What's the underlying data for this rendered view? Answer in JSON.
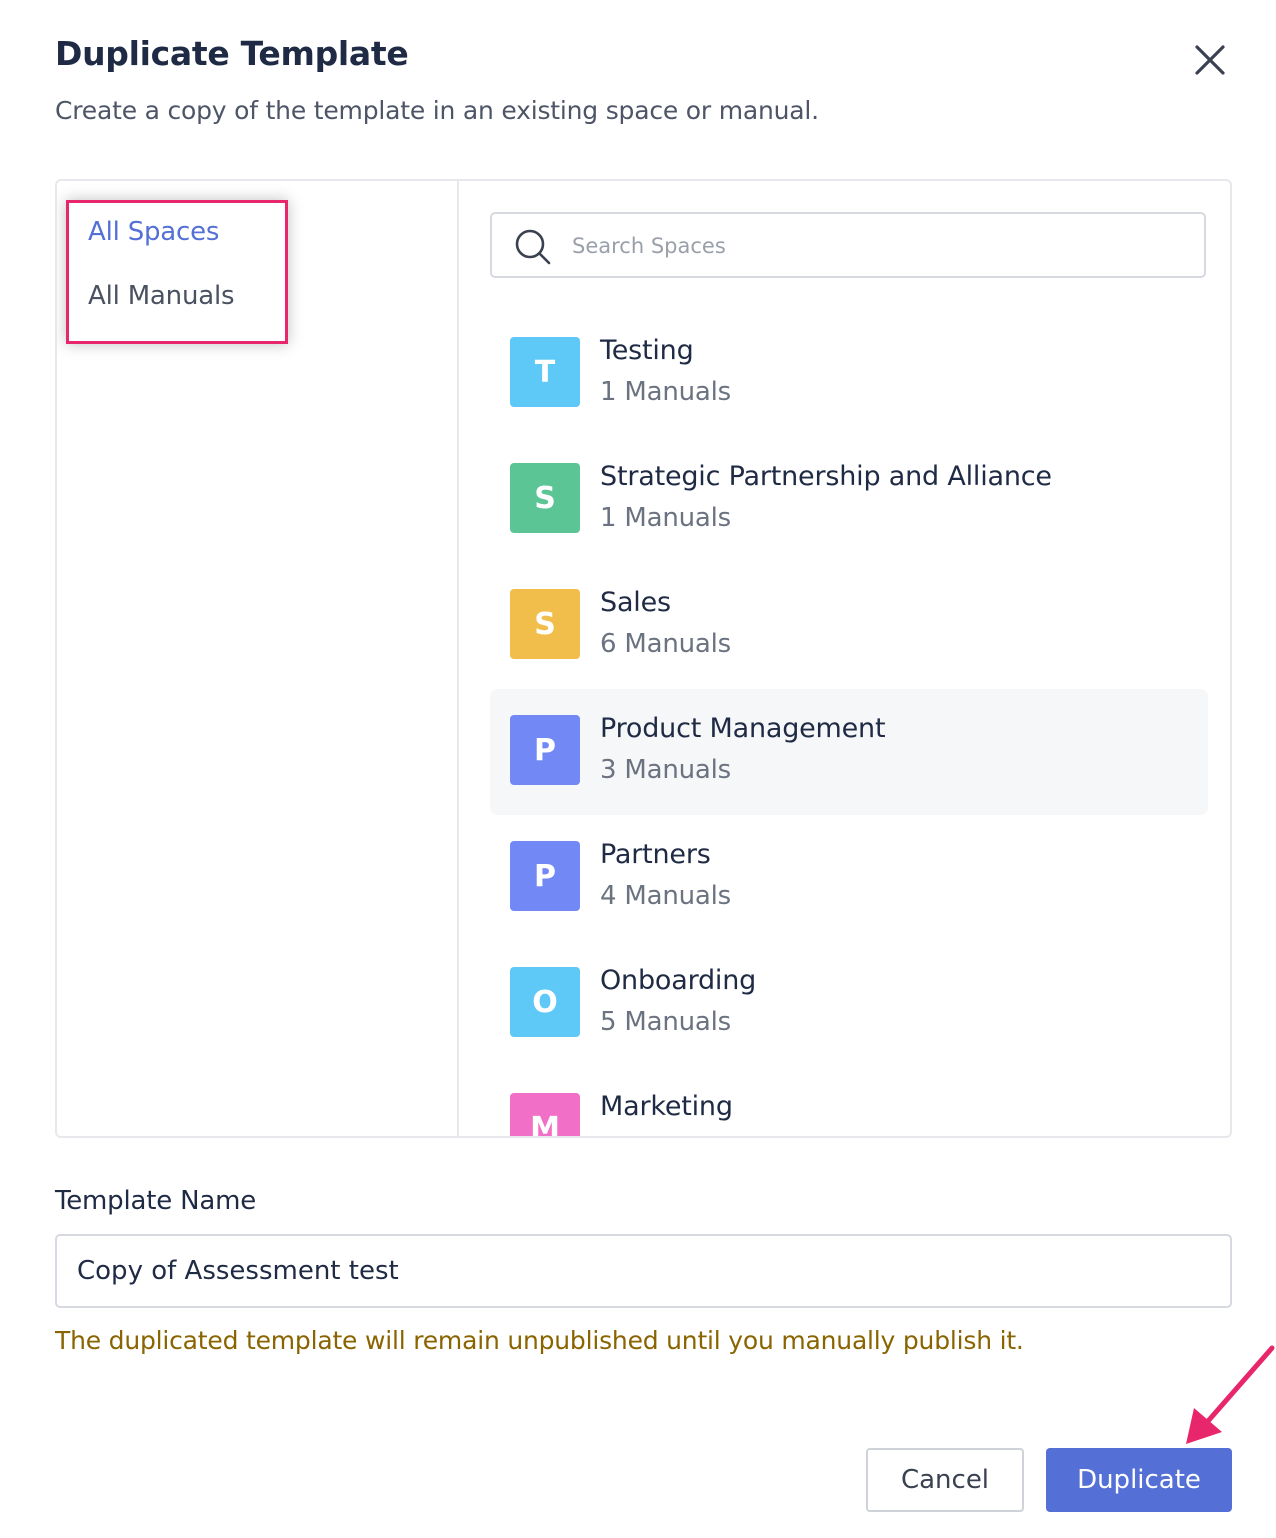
{
  "dialog": {
    "title": "Duplicate Template",
    "subtitle": "Create a copy of the template in an existing space or manual.",
    "close_icon": "close-icon"
  },
  "nav": {
    "items": [
      {
        "label": "All Spaces",
        "active": true
      },
      {
        "label": "All Manuals",
        "active": false
      }
    ]
  },
  "search": {
    "placeholder": "Search Spaces",
    "value": ""
  },
  "spaces": [
    {
      "initial": "T",
      "name": "Testing",
      "count": "1 Manuals",
      "color": "#5ec8f6"
    },
    {
      "initial": "S",
      "name": "Strategic Partnership and Alliance",
      "count": "1 Manuals",
      "color": "#5cc595"
    },
    {
      "initial": "S",
      "name": "Sales",
      "count": "6 Manuals",
      "color": "#f2be4b"
    },
    {
      "initial": "P",
      "name": "Product Management",
      "count": "3 Manuals",
      "color": "#7289f5"
    },
    {
      "initial": "P",
      "name": "Partners",
      "count": "4 Manuals",
      "color": "#7289f5"
    },
    {
      "initial": "O",
      "name": "Onboarding",
      "count": "5 Manuals",
      "color": "#5ec8f6"
    },
    {
      "initial": "M",
      "name": "Marketing",
      "count": "",
      "color": "#f26fc8"
    }
  ],
  "template_name": {
    "label": "Template Name",
    "value": "Copy of Assessment test"
  },
  "warning": "The duplicated template will remain unpublished until you manually publish it.",
  "buttons": {
    "cancel": "Cancel",
    "duplicate": "Duplicate"
  },
  "colors": {
    "accent": "#5470d6",
    "highlight_border": "#e8266b",
    "warning_text": "#8a6400"
  }
}
